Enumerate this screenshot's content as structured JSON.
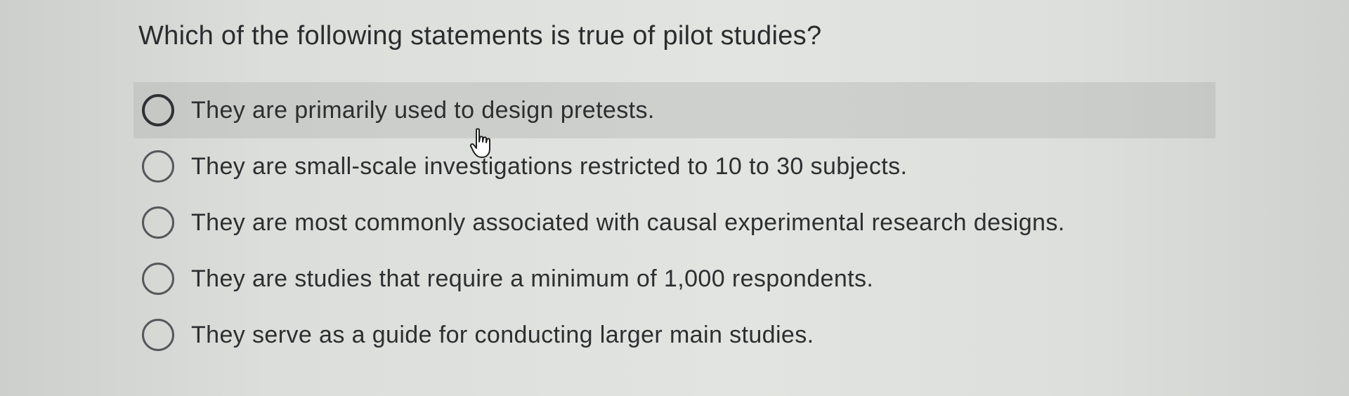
{
  "question": {
    "text": "Which of the following statements is true of pilot studies?"
  },
  "options": [
    {
      "label": "They are primarily used to design pretests.",
      "selected": false,
      "hovered": true
    },
    {
      "label": "They are small-scale investigations restricted to 10 to 30 subjects.",
      "selected": false,
      "hovered": false
    },
    {
      "label": "They are most commonly associated with causal experimental research designs.",
      "selected": false,
      "hovered": false
    },
    {
      "label": "They are studies that require a minimum of 1,000 respondents.",
      "selected": false,
      "hovered": false
    },
    {
      "label": "They serve as a guide for conducting larger main studies.",
      "selected": false,
      "hovered": false
    }
  ],
  "cursor": {
    "icon": "hand-pointer-icon"
  }
}
